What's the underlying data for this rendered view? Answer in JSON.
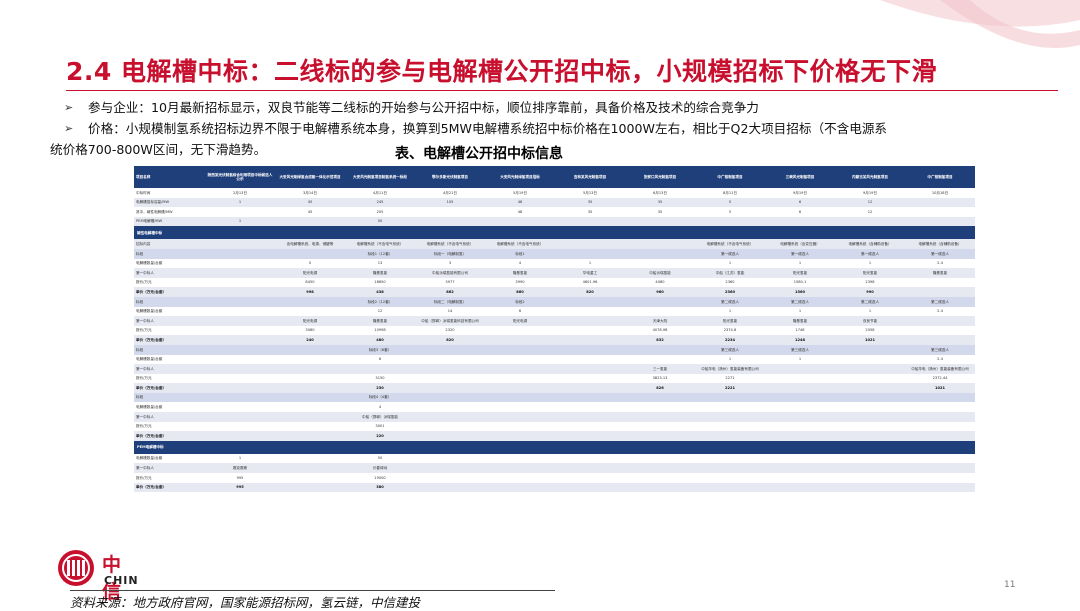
{
  "slide": {
    "title": "2.4 电解槽中标：二线标的参与电解槽公开招中标，小规模招标下价格无下滑",
    "bullet1": "参与企业：10月最新招标显示，双良节能等二线标的开始参与公开招中标，顺位排序靠前，具备价格及技术的综合竞争力",
    "bullet2a": "价格：小规模制氢系统招标边界不限于电解槽系统本身，换算到5MW电解槽系统招中标价格在1000W左右，相比于Q2大项目招标（不含电源系",
    "bullet2b": "统价格700-800W区间，无下滑趋势。",
    "bullet_marker": "➢",
    "table_caption": "表、电解槽公开招中标信息",
    "source": "资料来源：地方政府官网，国家能源招标网，氢云链，中信建投",
    "page_number": "11",
    "logo_cn": "中信",
    "logo_en": "CHIN",
    "logo_icon": "citic-logo-icon",
    "brand_color": "#c8102e",
    "table_header_color": "#1f3f7a"
  },
  "table": {
    "rows": [
      {
        "type": "hdr",
        "cells": [
          "项目名称",
          "陕西某光伏制氢综合利用项目中标候选人公示",
          "大安风光制绿氢合成氨一体化示范项目",
          "大安风光制氢项目制氢系统一标段",
          "鄂尔多斯光伏制氢项目",
          "大安风光制绿氢项目招标",
          "吉林某风光制氢项目",
          "张家口风光制氢项目",
          "中广核制氢项目",
          "三峡风光制氢项目",
          "内蒙古某风光制氢项目",
          "中广核制氢项目"
        ]
      },
      {
        "type": "w",
        "cells": [
          "中标时间",
          "2月13日",
          "3月14日",
          "4月11日",
          "4月21日",
          "5月19日",
          "5月13日",
          "6月13日",
          "8月11日",
          "9月19日",
          "9月19日",
          "10月18日"
        ]
      },
      {
        "type": "g",
        "cells": [
          "电解槽招标容量/MW",
          "1",
          "45",
          "245",
          "105",
          "48",
          "35",
          "35",
          "5",
          "6",
          "12",
          ""
        ]
      },
      {
        "type": "w",
        "cells": [
          "其中，碱性电解槽/MW",
          "",
          "45",
          "205",
          "",
          "48",
          "35",
          "35",
          "5",
          "6",
          "12",
          ""
        ]
      },
      {
        "type": "g",
        "cells": [
          "PEM电解槽/MW",
          "1",
          "",
          "50",
          "",
          "",
          "",
          "",
          "",
          "",
          "",
          ""
        ]
      },
      {
        "type": "sec",
        "cells": [
          "碱性电解槽中标",
          "",
          "",
          "",
          "",
          "",
          "",
          "",
          "",
          "",
          "",
          ""
        ]
      },
      {
        "type": "g",
        "cells": [
          "招标内容",
          "",
          "含电解槽系统、电源、储罐等",
          "电解槽系统（不含电气系统）",
          "电解槽系统（不含电气系统）",
          "电解槽系统（不含电气系统）",
          "",
          "",
          "电解槽系统（不含电气系统）",
          "电解槽系统（含变压器）",
          "电解槽系统（含辅助设备）",
          "电解槽系统（含辅助设备）"
        ]
      },
      {
        "type": "l",
        "cells": [
          "标段",
          "",
          "",
          "标段1（12套）",
          "标段一（电解制氢）",
          "标段1",
          "",
          "",
          "第一候选人",
          "第一候选人",
          "第一候选人",
          "第一候选人"
        ]
      },
      {
        "type": "w",
        "cells": [
          "电解槽数量/台套",
          "",
          "0",
          "13",
          "3",
          "4",
          "1",
          "",
          "1",
          "1",
          "1",
          "2.4"
        ]
      },
      {
        "type": "g",
        "cells": [
          "第一中标人",
          "",
          "阳光电源",
          "隆基氢能",
          "中船派瑞氢能有限公司",
          "隆基氢能",
          "华电重工",
          "中船派瑞氢能",
          "中船（江苏）氢能",
          "阳光氢能",
          "阳光氢能",
          "隆基氢能"
        ]
      },
      {
        "type": "w",
        "cells": [
          "报价/万元",
          "",
          "8450",
          "18650",
          "3977",
          "3990",
          "4601.96",
          "4080",
          "2360",
          "1580.1",
          "2398",
          ""
        ]
      },
      {
        "type": "g b",
        "cells": [
          "单价（万元/台套）",
          "",
          "998",
          "438",
          "862",
          "860",
          "820",
          "960",
          "2360",
          "1560",
          "990",
          ""
        ]
      },
      {
        "type": "l",
        "cells": [
          "标段",
          "",
          "",
          "标段2（12套）",
          "标段二（电解制氢）",
          "标段2",
          "",
          "",
          "第二候选人",
          "第二候选人",
          "第二候选人",
          "第二候选人"
        ]
      },
      {
        "type": "w",
        "cells": [
          "电解槽数量/台套",
          "",
          "",
          "12",
          "14",
          "6",
          "",
          "",
          "1",
          "1",
          "1",
          "2.4"
        ]
      },
      {
        "type": "g",
        "cells": [
          "第一中标人",
          "",
          "阳光电源",
          "隆基氢能",
          "中船（邯郸）派瑞氢能科技有限公司",
          "阳光电源",
          "",
          "天津大陆",
          "阳光氢能",
          "隆基氢能",
          "双良节能",
          ""
        ]
      },
      {
        "type": "w",
        "cells": [
          "报价/万元",
          "",
          "3080",
          "10998",
          "2320",
          "",
          "",
          "4078.98",
          "2374.8",
          "1748",
          "2058",
          ""
        ]
      },
      {
        "type": "g b",
        "cells": [
          "单价（万元/台套）",
          "",
          "240",
          "480",
          "820",
          "",
          "",
          "832",
          "2234",
          "1248",
          "1021",
          ""
        ]
      },
      {
        "type": "l",
        "cells": [
          "标段",
          "",
          "",
          "标段3（6套）",
          "",
          "",
          "",
          "",
          "第三候选人",
          "第三候选人",
          "",
          "第三候选人"
        ]
      },
      {
        "type": "w",
        "cells": [
          "电解槽数量/台套",
          "",
          "",
          "6",
          "",
          "",
          "",
          "",
          "1",
          "1",
          "",
          "2.4"
        ]
      },
      {
        "type": "g",
        "cells": [
          "第一中标人",
          "",
          "",
          "",
          "",
          "",
          "",
          "三一氢能",
          "中船华电（扬州）氢能装备有限公司",
          "",
          "",
          "中船华电（扬州）氢能装备有限公司"
        ]
      },
      {
        "type": "w",
        "cells": [
          "报价/万元",
          "",
          "",
          "3150",
          "",
          "",
          "",
          "3823.13",
          "2271",
          "",
          "",
          "2372.44"
        ]
      },
      {
        "type": "g b",
        "cells": [
          "单价（万元/台套）",
          "",
          "",
          "230",
          "",
          "",
          "",
          "826",
          "2221",
          "",
          "",
          "1021"
        ]
      },
      {
        "type": "l",
        "cells": [
          "标段",
          "",
          "",
          "标段4（4套）",
          "",
          "",
          "",
          "",
          "",
          "",
          "",
          ""
        ]
      },
      {
        "type": "w",
        "cells": [
          "电解槽数量/台套",
          "",
          "",
          "4",
          "",
          "",
          "",
          "",
          "",
          "",
          "",
          ""
        ]
      },
      {
        "type": "g",
        "cells": [
          "第一中标人",
          "",
          "",
          "中船（邯郸）派瑞氢能",
          "",
          "",
          "",
          "",
          "",
          "",
          "",
          ""
        ]
      },
      {
        "type": "w",
        "cells": [
          "报价/万元",
          "",
          "",
          "3001",
          "",
          "",
          "",
          "",
          "",
          "",
          "",
          ""
        ]
      },
      {
        "type": "g b",
        "cells": [
          "单价（万元/台套）",
          "",
          "",
          "220",
          "",
          "",
          "",
          "",
          "",
          "",
          "",
          ""
        ]
      },
      {
        "type": "sec",
        "cells": [
          "PEM电解槽中标",
          "",
          "",
          "",
          "",
          "",
          "",
          "",
          "",
          "",
          "",
          ""
        ]
      },
      {
        "type": "w",
        "cells": [
          "电解槽数量/台套",
          "1",
          "",
          "50",
          "",
          "",
          "",
          "",
          "",
          "",
          "",
          ""
        ]
      },
      {
        "type": "g",
        "cells": [
          "第一中标人",
          "赛克赛斯",
          "",
          "长春绿动",
          "",
          "",
          "",
          "",
          "",
          "",
          "",
          ""
        ]
      },
      {
        "type": "w",
        "cells": [
          "报价/万元",
          "995",
          "",
          "19000",
          "",
          "",
          "",
          "",
          "",
          "",
          "",
          ""
        ]
      },
      {
        "type": "g b",
        "cells": [
          "单价（万元/台套）",
          "995",
          "",
          "380",
          "",
          "",
          "",
          "",
          "",
          "",
          "",
          ""
        ]
      }
    ]
  }
}
